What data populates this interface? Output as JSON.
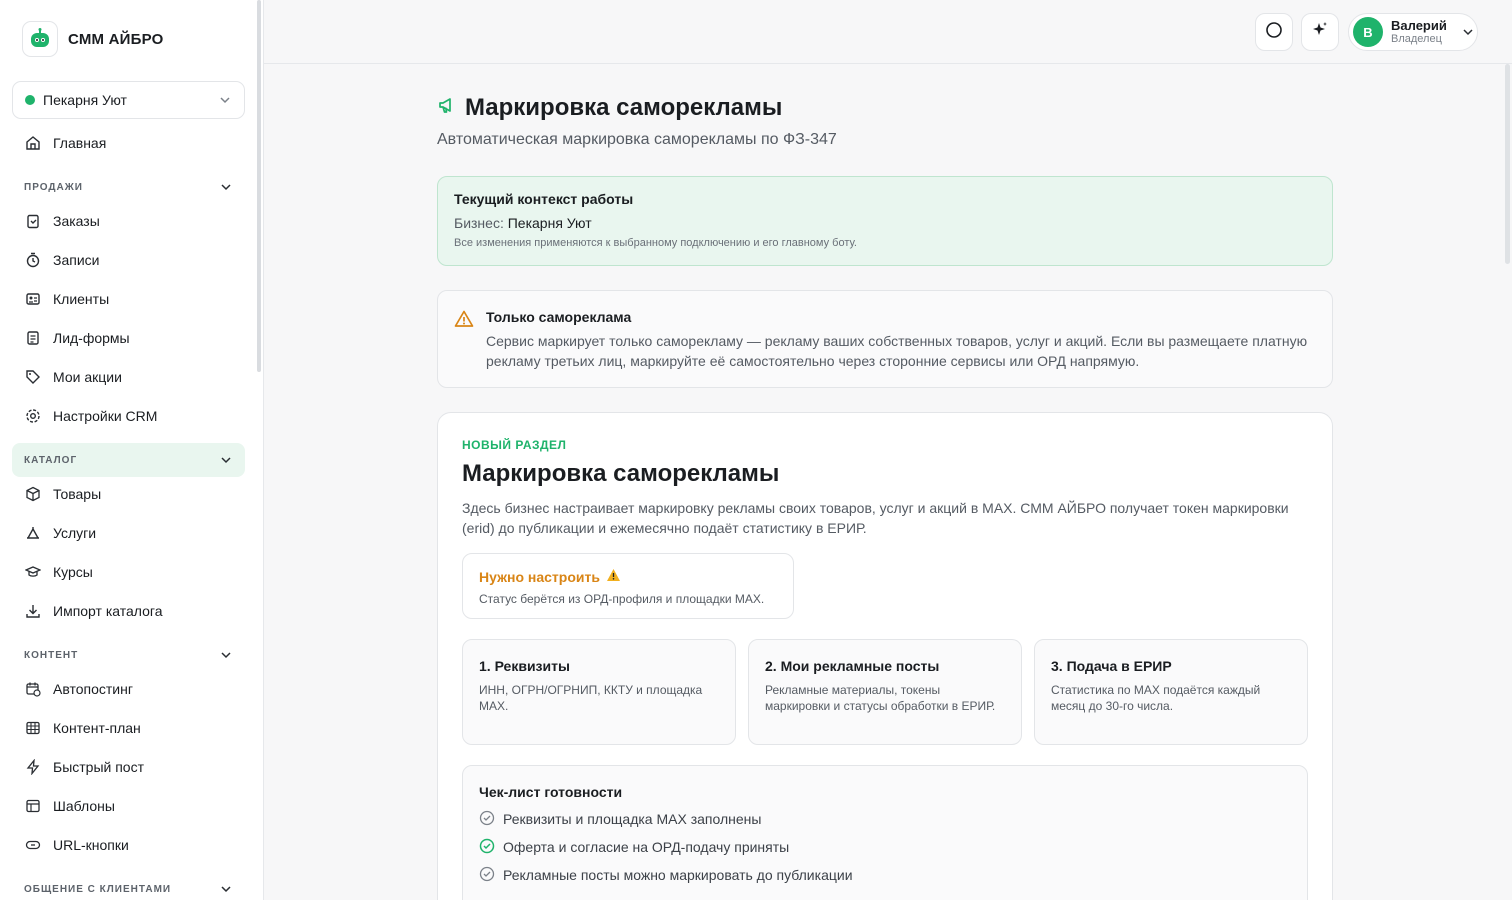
{
  "brand": {
    "name": "СММ АЙБРО"
  },
  "business_select": {
    "value": "Пекарня Уют"
  },
  "nav": {
    "home": "Главная",
    "sections": {
      "sales": "ПРОДАЖИ",
      "catalog": "КАТАЛОГ",
      "content": "КОНТЕНТ",
      "communication": "ОБЩЕНИЕ С КЛИЕНТАМИ"
    },
    "sales_items": [
      "Заказы",
      "Записи",
      "Клиенты",
      "Лид-формы",
      "Мои акции",
      "Настройки CRM"
    ],
    "catalog_items": [
      "Товары",
      "Услуги",
      "Курсы",
      "Импорт каталога"
    ],
    "content_items": [
      "Автопостинг",
      "Контент-план",
      "Быстрый пост",
      "Шаблоны",
      "URL-кнопки"
    ]
  },
  "user": {
    "initial": "В",
    "name": "Валерий",
    "role": "Владелец"
  },
  "page": {
    "title": "Маркировка саморекламы",
    "subtitle": "Автоматическая маркировка саморекламы по ФЗ-347"
  },
  "context": {
    "title": "Текущий контекст работы",
    "business_label": "Бизнес:",
    "business_value": "Пекарня Уют",
    "note": "Все изменения применяются к выбранному подключению и его главному боту."
  },
  "warning": {
    "title": "Только самореклама",
    "text": "Сервис маркирует только саморекламу — рекламу ваших собственных товаров, услуг и акций. Если вы размещаете платную рекламу третьих лиц, маркируйте её самостоятельно через сторонние сервисы или ОРД напрямую."
  },
  "card": {
    "badge": "НОВЫЙ РАЗДЕЛ",
    "title": "Маркировка саморекламы",
    "description": "Здесь бизнес настраивает маркировку рекламы своих товаров, услуг и акций в MAX. СММ АЙБРО получает токен маркировки (erid) до публикации и ежемесячно подаёт статистику в ЕРИР.",
    "status": {
      "title": "Нужно настроить",
      "note": "Статус берётся из ОРД-профиля и площадки MAX."
    },
    "steps": [
      {
        "title": "1. Реквизиты",
        "text": "ИНН, ОГРН/ОГРНИП, ККТУ и площадка MAX."
      },
      {
        "title": "2. Мои рекламные посты",
        "text": "Рекламные материалы, токены маркировки и статусы обработки в ЕРИР."
      },
      {
        "title": "3. Подача в ЕРИР",
        "text": "Статистика по MAX подаётся каждый месяц до 30-го числа."
      }
    ],
    "checklist": {
      "title": "Чек-лист готовности",
      "items": [
        {
          "label": "Реквизиты и площадка MAX заполнены",
          "done": false
        },
        {
          "label": "Оферта и согласие на ОРД-подачу приняты",
          "done": true
        },
        {
          "label": "Рекламные посты можно маркировать до публикации",
          "done": false
        }
      ]
    }
  },
  "colors": {
    "accent": "#1fb36b",
    "warning": "#d98516",
    "context_bg": "#e9f6ef"
  }
}
